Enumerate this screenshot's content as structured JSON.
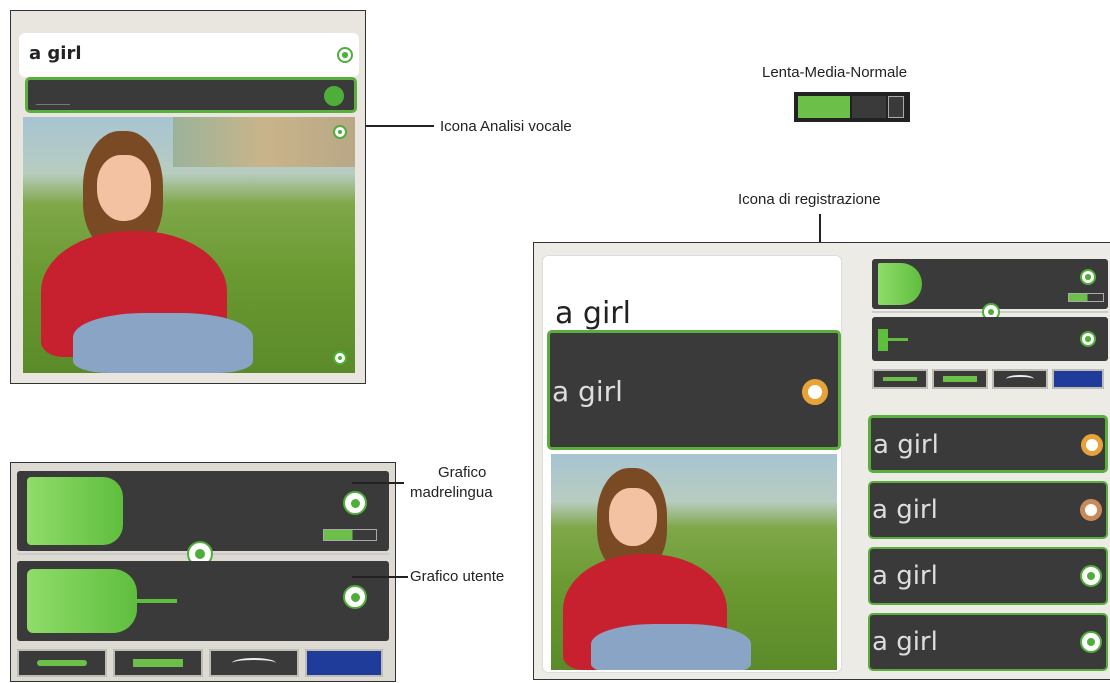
{
  "topleft": {
    "word": "a girl"
  },
  "right": {
    "word": "a girl",
    "input_word": "a girl",
    "list": [
      "a girl",
      "a girl",
      "a girl",
      "a girl"
    ]
  },
  "callouts": {
    "speech_icon": "Icona Analisi vocale",
    "speed": "Lenta-Media-Normale",
    "record_icon": "Icona di registrazione",
    "native_graph_line1": "Grafico",
    "native_graph_line2": "madrelingua",
    "user_graph": "Grafico utente"
  },
  "speed_control": {
    "level": 0.5
  },
  "colors": {
    "accent_green": "#5cae3c",
    "panel_dark": "#3a3a3a",
    "sweater_red": "#c7212f"
  },
  "icons": [
    "speaker-icon",
    "record-icon",
    "speech-analysis-icon",
    "waveform-tab-icon",
    "pitch-tab-icon",
    "spectrum-tab-icon"
  ]
}
